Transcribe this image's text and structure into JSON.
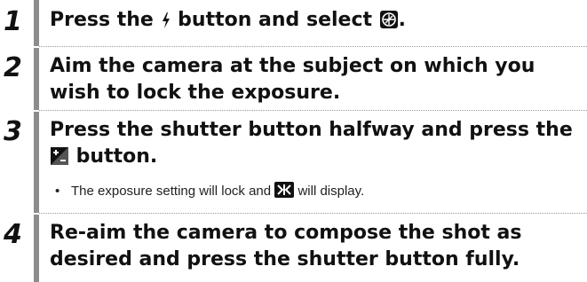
{
  "steps": [
    {
      "number": "1",
      "text_a": "Press the ",
      "flash_icon": "flash-icon",
      "text_b": " button and select ",
      "ael_icon": "exposure-lock-mode-icon",
      "text_c": "."
    },
    {
      "number": "2",
      "line1": "Aim the camera at the subject on which you",
      "line2": "wish to lock the exposure."
    },
    {
      "number": "3",
      "line1": "Press the shutter button halfway and press the",
      "comp_icon": "exposure-compensation-icon",
      "line2_text": " button.",
      "note_bullet": "•",
      "note_a": "The exposure setting will lock and ",
      "ael_display_icon": "ael-indicator-icon",
      "note_b": " will display."
    },
    {
      "number": "4",
      "line1": "Re-aim the camera to compose the shot as",
      "line2": "desired and press the shutter button fully."
    }
  ],
  "colors": {
    "bar": "#8c8c8c",
    "text": "#111111",
    "rule": "#9a9a9a"
  }
}
